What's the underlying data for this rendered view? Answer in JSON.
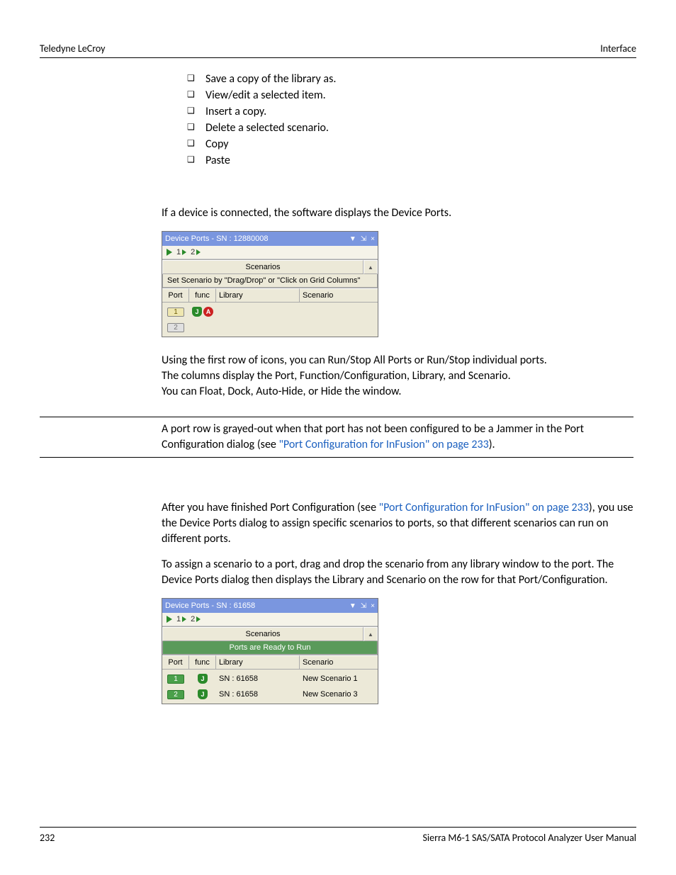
{
  "header": {
    "left": "Teledyne LeCroy",
    "right": "Interface"
  },
  "bullets": [
    "Save a copy of the library as.",
    "View/edit a selected item.",
    "Insert a copy.",
    "Delete a selected scenario.",
    "Copy",
    "Paste"
  ],
  "intro1": "If a device is connected, the software displays the Device Ports.",
  "panel1": {
    "title": "Device Ports - SN : 12880008",
    "toolbar": {
      "p1": "1",
      "p2": "2"
    },
    "scenarios_label": "Scenarios",
    "instruction": "Set Scenario by \"Drag/Drop\" or \"Click on Grid Columns\"",
    "cols": {
      "port": "Port",
      "func": "func",
      "library": "Library",
      "scenario": "Scenario"
    },
    "rows": [
      {
        "port": "1",
        "func_shield": "J",
        "func_a": "A",
        "lib": "",
        "scen": ""
      },
      {
        "port": "2",
        "gray": true,
        "lib": "",
        "scen": ""
      }
    ]
  },
  "post1_line1": "Using the first row of icons, you can Run/Stop All Ports or Run/Stop individual ports.",
  "post1_line2": "The columns display the Port, Function/Configuration, Library, and Scenario.",
  "post1_line3": "You can Float, Dock, Auto-Hide, or Hide the window.",
  "note": {
    "pre": "A port row is grayed-out when that port has not been configured to be a Jammer in the Port Configuration dialog (see ",
    "link": "\"Port Configuration for InFusion\" on page 233",
    "post": ")."
  },
  "assign1": {
    "pre": "After you have finished Port Configuration (see ",
    "link": "\"Port Configuration for InFusion\" on page 233",
    "post": "), you use the Device Ports dialog to assign specific scenarios to ports, so that different scenarios can run on different ports."
  },
  "assign2": "To assign a scenario to a port, drag and drop the scenario from any library window to the port. The Device Ports dialog then displays the Library and Scenario on the row for that Port/Configuration.",
  "panel2": {
    "title": "Device Ports - SN : 61658",
    "toolbar": {
      "p1": "1",
      "p2": "2"
    },
    "scenarios_label": "Scenarios",
    "instruction": "Ports are Ready to Run",
    "cols": {
      "port": "Port",
      "func": "func",
      "library": "Library",
      "scenario": "Scenario"
    },
    "rows": [
      {
        "port": "1",
        "func_shield": "J",
        "lib": "SN : 61658",
        "scen": "New Scenario 1"
      },
      {
        "port": "2",
        "func_shield": "J",
        "lib": "SN : 61658",
        "scen": "New Scenario 3"
      }
    ]
  },
  "footer": {
    "page": "232",
    "manual": "Sierra M6-1 SAS/SATA Protocol Analyzer User Manual"
  }
}
